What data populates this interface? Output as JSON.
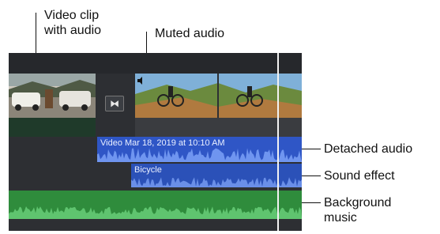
{
  "callouts": {
    "video_clip": "Video clip\nwith audio",
    "muted_audio": "Muted audio",
    "detached_audio": "Detached audio",
    "sound_effect": "Sound effect",
    "background_music": "Background\nmusic"
  },
  "timeline": {
    "transition_icon": "⧓",
    "detached_clip_name": "Video Mar 18, 2019 at 10:10 AM",
    "sound_effect_name": "Bicycle",
    "mute_icon": "speaker-muted-icon"
  },
  "colors": {
    "detached_audio": "#2f56c6",
    "sound_effect": "#2b51b8",
    "background_music": "#2f8c3c",
    "timeline_bg": "#2d2f33"
  }
}
